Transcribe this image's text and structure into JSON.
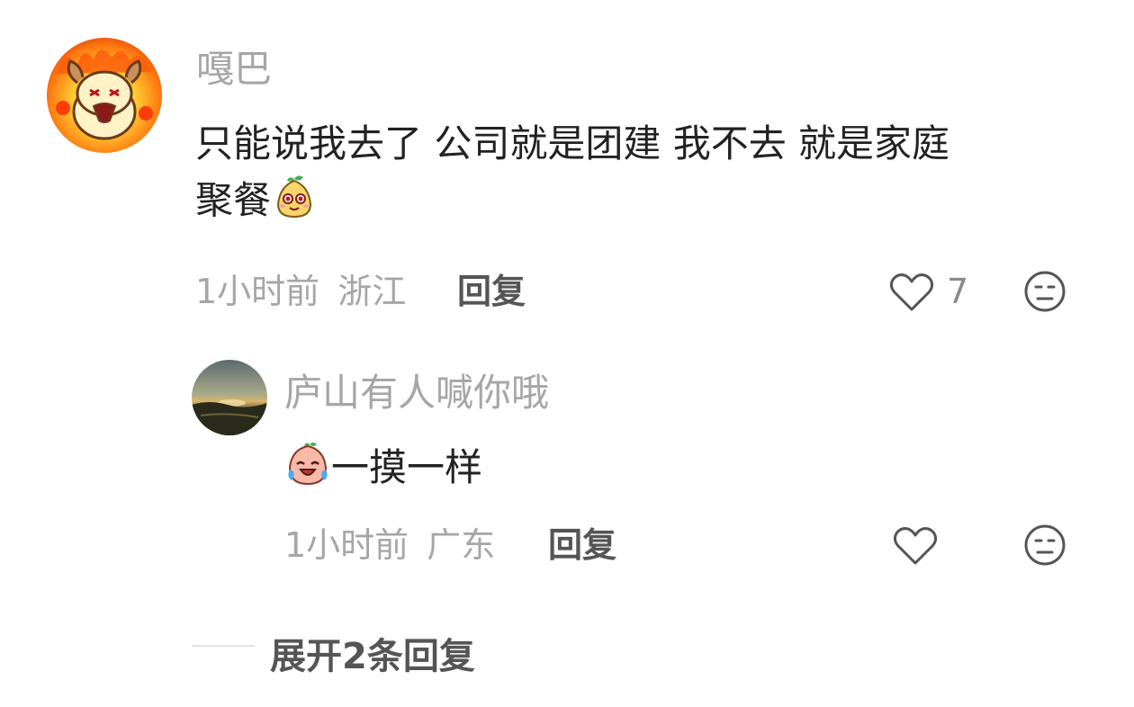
{
  "comment": {
    "username": "嘎巴",
    "text_line1": "只能说我去了 公司就是团建 我不去 就是家庭",
    "text_line2": "聚餐",
    "emoji": "smiling-pear-emoji",
    "time": "1小时前",
    "location": "浙江",
    "reply_label": "回复",
    "like_count": "7"
  },
  "reply": {
    "username": "庐山有人喊你哦",
    "emoji": "laughing-tears-peach-emoji",
    "text": "一摸一样",
    "time": "1小时前",
    "location": "广东",
    "reply_label": "回复"
  },
  "expand": {
    "label": "展开2条回复"
  },
  "icons": {
    "like": "heart-outline-icon",
    "dislike": "meh-face-icon"
  },
  "colors": {
    "username": "#a6a6a6",
    "text": "#222222",
    "meta": "#a6a6a6",
    "action": "#555555"
  }
}
